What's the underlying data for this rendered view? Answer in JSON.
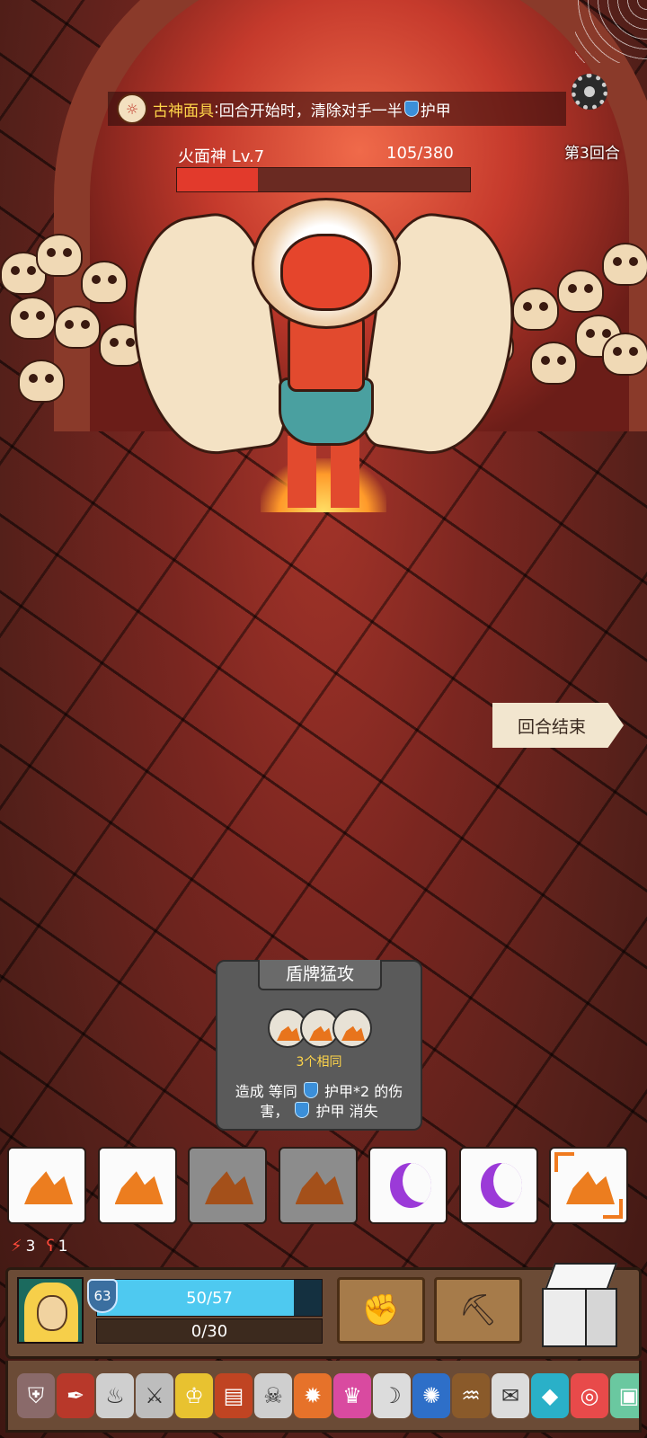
{
  "hud": {
    "buff_name": "古神面具",
    "buff_sep": ":",
    "buff_desc_a": " 回合开始时，清除对手一半",
    "buff_desc_b": "护甲",
    "round_label": "第3回合",
    "settings_icon": "gear-icon"
  },
  "boss": {
    "name": "火面神  Lv.7",
    "hp_text": "105/380",
    "hp_current": 105,
    "hp_max": 380
  },
  "end_turn_label": "回合结束",
  "skill": {
    "title": "盾牌猛攻",
    "condition": "3个相同",
    "desc_1": "造成 等同",
    "desc_2": "护甲*2 的伤害，",
    "desc_3": "护甲 消失",
    "slots": [
      "rock",
      "rock",
      "rock"
    ]
  },
  "dice": [
    {
      "face": "rock",
      "state": "ready"
    },
    {
      "face": "rock",
      "state": "ready"
    },
    {
      "face": "rock",
      "state": "used"
    },
    {
      "face": "rock",
      "state": "used"
    },
    {
      "face": "moon",
      "state": "ready"
    },
    {
      "face": "moon",
      "state": "ready"
    },
    {
      "face": "rock",
      "state": "selected"
    }
  ],
  "stats": [
    {
      "icon": "attack-icon",
      "value": "3"
    },
    {
      "icon": "bleed-icon",
      "value": "1"
    }
  ],
  "player": {
    "armor": "63",
    "hp_text": "50/57",
    "hp_current": 50,
    "hp_max": 57,
    "xp_text": "0/30",
    "xp_current": 0,
    "xp_max": 30
  },
  "colors": {
    "buff_name": "#ffd54a",
    "boss_hp": "#e23a2c",
    "player_hp": "#4ec9f0",
    "rock": "#ec7d1f",
    "moon": "#9b3ad8"
  }
}
